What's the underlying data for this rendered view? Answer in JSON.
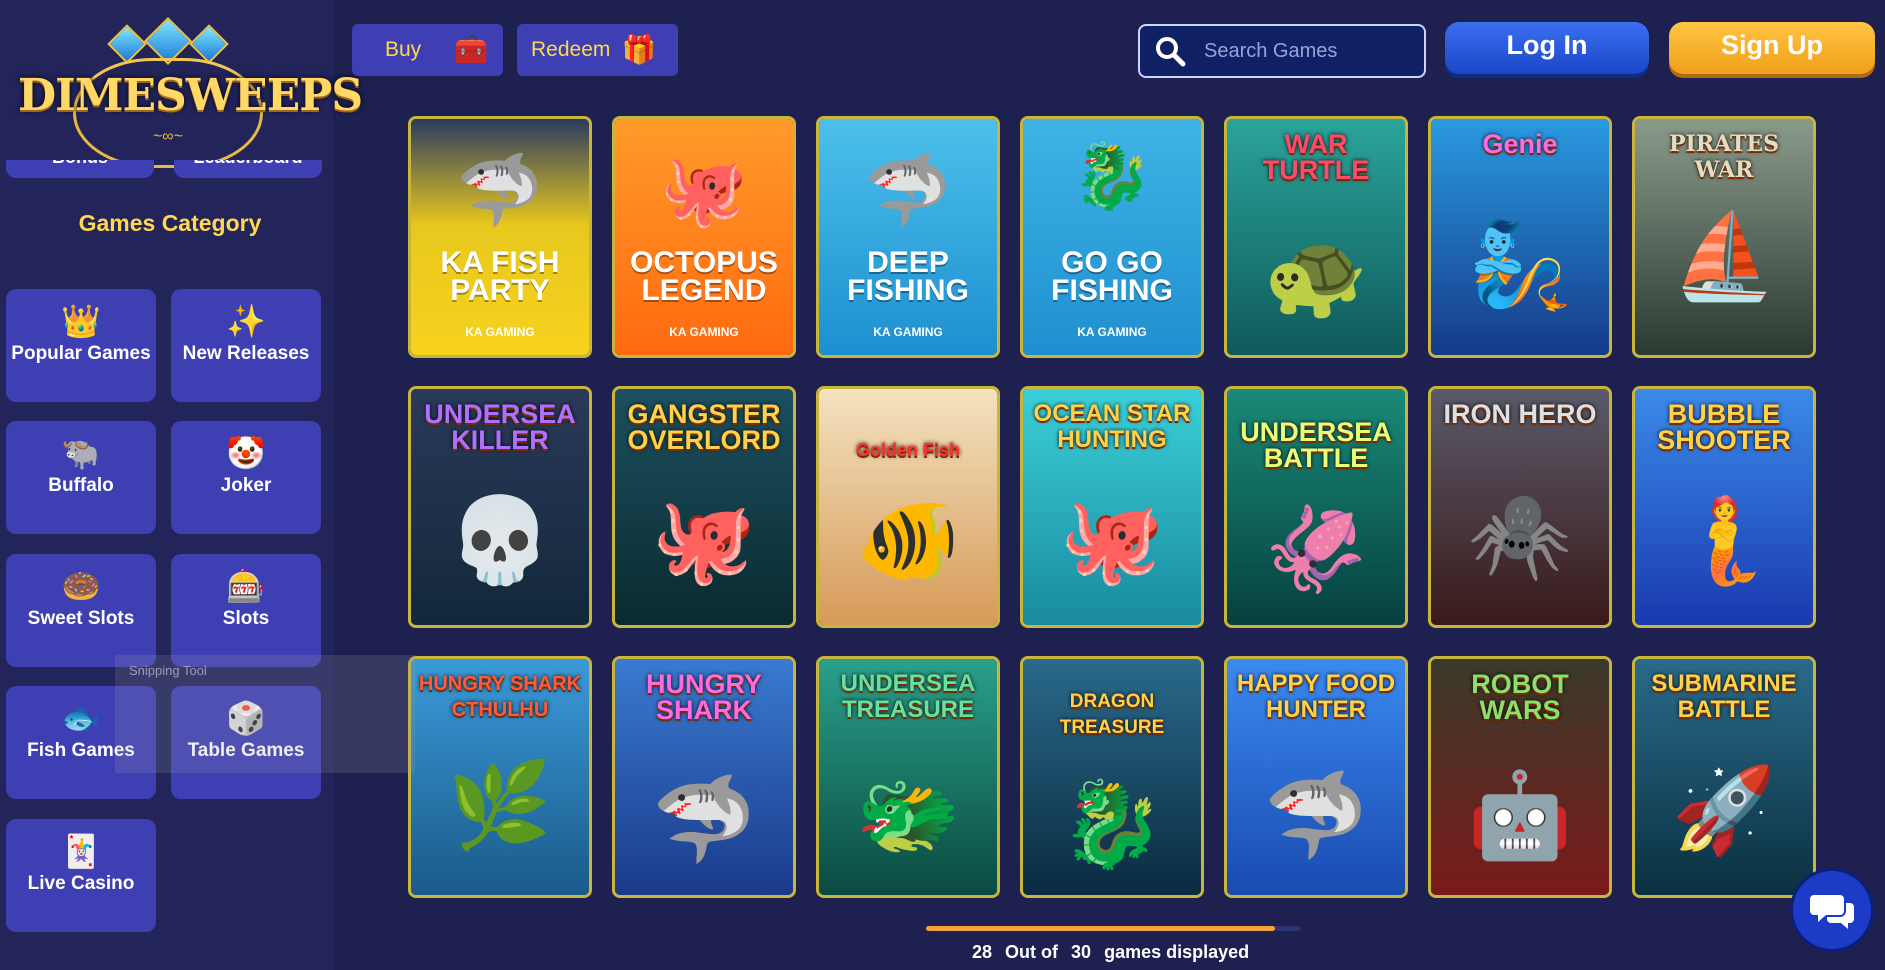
{
  "brand": {
    "name": "DIMESWEEPS"
  },
  "header": {
    "buy_label": "Buy",
    "redeem_label": "Redeem",
    "search_placeholder": "Search Games",
    "login_label": "Log In",
    "signup_label": "Sign Up"
  },
  "sidebar": {
    "cut_items": [
      "Bonus",
      "Leaderboard"
    ],
    "category_title": "Games Category",
    "categories": [
      {
        "label": "Popular Games",
        "icon": "crown-icon"
      },
      {
        "label": "New Releases",
        "icon": "stars-icon"
      },
      {
        "label": "Buffalo",
        "icon": "buffalo-icon"
      },
      {
        "label": "Joker",
        "icon": "joker-icon"
      },
      {
        "label": "Sweet Slots",
        "icon": "donut-icon"
      },
      {
        "label": "Slots",
        "icon": "slot-machine-icon"
      },
      {
        "label": "Fish Games",
        "icon": "fish-icon"
      },
      {
        "label": "Table Games",
        "icon": "table-icon"
      },
      {
        "label": "Live Casino",
        "icon": "cards-icon"
      }
    ]
  },
  "games": [
    {
      "title": "KA FISH PARTY",
      "provider": "KA GAMING",
      "bg": "#f7d21e"
    },
    {
      "title": "OCTOPUS LEGEND",
      "provider": "KA GAMING",
      "bg": "#ff7a12"
    },
    {
      "title": "DEEP FISHING",
      "provider": "KA GAMING",
      "bg": "#27a2d9"
    },
    {
      "title": "GO GO FISHING",
      "provider": "KA GAMING",
      "bg": "#2a9fd4"
    },
    {
      "title": "WAR TURTLE",
      "provider": "",
      "bg": "#1f8a7a"
    },
    {
      "title": "Genie",
      "provider": "",
      "bg": "#1f6fc4"
    },
    {
      "title": "PIRATES WAR",
      "provider": "",
      "bg": "#3a4a3a"
    },
    {
      "title": "UNDERSEA KILLER",
      "provider": "",
      "bg": "#1c3350"
    },
    {
      "title": "GANGSTER OVERLORD",
      "provider": "",
      "bg": "#14404a"
    },
    {
      "title": "Golden Fish",
      "provider": "",
      "bg": "#e8c89a"
    },
    {
      "title": "OCEAN STAR HUNTING",
      "provider": "",
      "bg": "#27b6c4"
    },
    {
      "title": "UNDERSEA BATTLE",
      "provider": "",
      "bg": "#0f6a5a"
    },
    {
      "title": "IRON HERO",
      "provider": "",
      "bg": "#4a2a2a"
    },
    {
      "title": "BUBBLE SHOOTER",
      "provider": "",
      "bg": "#2458c8"
    },
    {
      "title": "HUNGRY SHARK CTHULHU",
      "provider": "",
      "bg": "#1f7ab0"
    },
    {
      "title": "HUNGRY SHARK",
      "provider": "",
      "bg": "#2a64b8"
    },
    {
      "title": "UNDERSEA TREASURE",
      "provider": "",
      "bg": "#177a6a"
    },
    {
      "title": "DRAGON TREASURE",
      "provider": "",
      "bg": "#1c4a6a"
    },
    {
      "title": "HAPPY FOOD HUNTER",
      "provider": "",
      "bg": "#1e6ad0"
    },
    {
      "title": "ROBOT WARS",
      "provider": "",
      "bg": "#5a1a1a"
    },
    {
      "title": "SUBMARINE BATTLE",
      "provider": "",
      "bg": "#1a4a60"
    }
  ],
  "footer": {
    "shown": "28",
    "out_of": "Out of",
    "total": "30",
    "suffix": "games displayed",
    "progress": 0.93
  },
  "overlay": {
    "snipping_label": "Snipping Tool"
  },
  "colors": {
    "accent_gold": "#ffd84d",
    "button_blue": "#3e3fb3",
    "login_blue": "#2a58e0",
    "signup_orange": "#f5a623"
  }
}
